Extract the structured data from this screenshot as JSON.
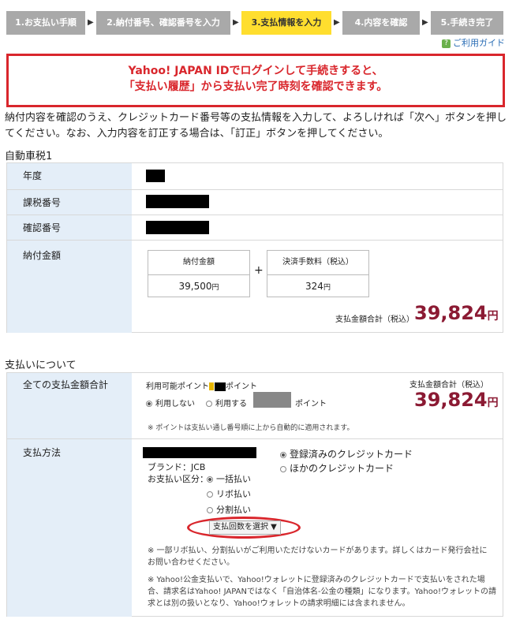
{
  "steps": [
    {
      "label": "1.お支払い手順"
    },
    {
      "label": "2.納付番号、確認番号を入力"
    },
    {
      "label": "3.支払情報を入力"
    },
    {
      "label": "4.内容を確認"
    },
    {
      "label": "5.手続き完了"
    }
  ],
  "step_arrow": "▶",
  "guide_link": "ご利用ガイド",
  "guide_icon_glyph": "?",
  "alert": {
    "line1": "Yahoo! JAPAN IDでログインして手続きすると、",
    "line2": "「支払い履歴」から支払い完了時刻を確認できます。"
  },
  "intro": "納付内容を確認のうえ、クレジットカード番号等の支払情報を入力して、よろしければ「次へ」ボタンを押してください。なお、入力内容を訂正する場合は、「訂正」ボタンを押してください。",
  "tax": {
    "title": "自動車税1",
    "year_label": "年度",
    "tax_number_label": "課税番号",
    "confirm_number_label": "確認番号",
    "amount_label": "納付金額",
    "payment_amount_header": "納付金額",
    "payment_amount_value": "39,500",
    "fee_header": "決済手数料（税込）",
    "fee_value": "324",
    "yen": "円",
    "plus": "+",
    "total_label": "支払金額合計（税込）",
    "total_value": "39,824",
    "total_unit": "円"
  },
  "payment": {
    "title": "支払いについて",
    "total_label": "全ての支払金額合計",
    "points_available": "利用可能ポイント",
    "points_suffix": "ポイント",
    "not_use": "利用しない",
    "use": "利用する",
    "point_unit": "ポイント",
    "total_right_label": "支払金額合計（税込）",
    "total_right_value": "39,824",
    "total_right_unit": "円",
    "points_note": "※ ポイントは支払い通し番号順に上から自動的に適用されます。",
    "method_label": "支払方法",
    "brand": "ブランド：JCB",
    "division_label": "お支払い区分：",
    "lump": "一括払い",
    "revolving": "リボ払い",
    "installment": "分割払い",
    "select_placeholder": "支払回数を選択 ▼",
    "registered_card": "登録済みのクレジットカード",
    "other_card": "ほかのクレジットカード",
    "note1": "※ 一部リボ払い、分割払いがご利用いただけないカードがあります。詳しくはカード発行会社にお問い合わせください。",
    "note2": "※ Yahoo!公金支払いで、Yahoo!ウォレットに登録済みのクレジットカードで支払いをされた場合、請求名はYahoo! JAPANではなく「自治体名-公金の種類」になります。Yahoo!ウォレットの請求とは別の扱いとなり、Yahoo!ウォレットの請求明細には含まれません。"
  },
  "colors": {
    "step_active": "#ffde2e",
    "step_inactive": "#a9a9a9",
    "alert_red": "#d9262c",
    "amount": "#8b1a33",
    "header_bg": "#e4eef8"
  }
}
